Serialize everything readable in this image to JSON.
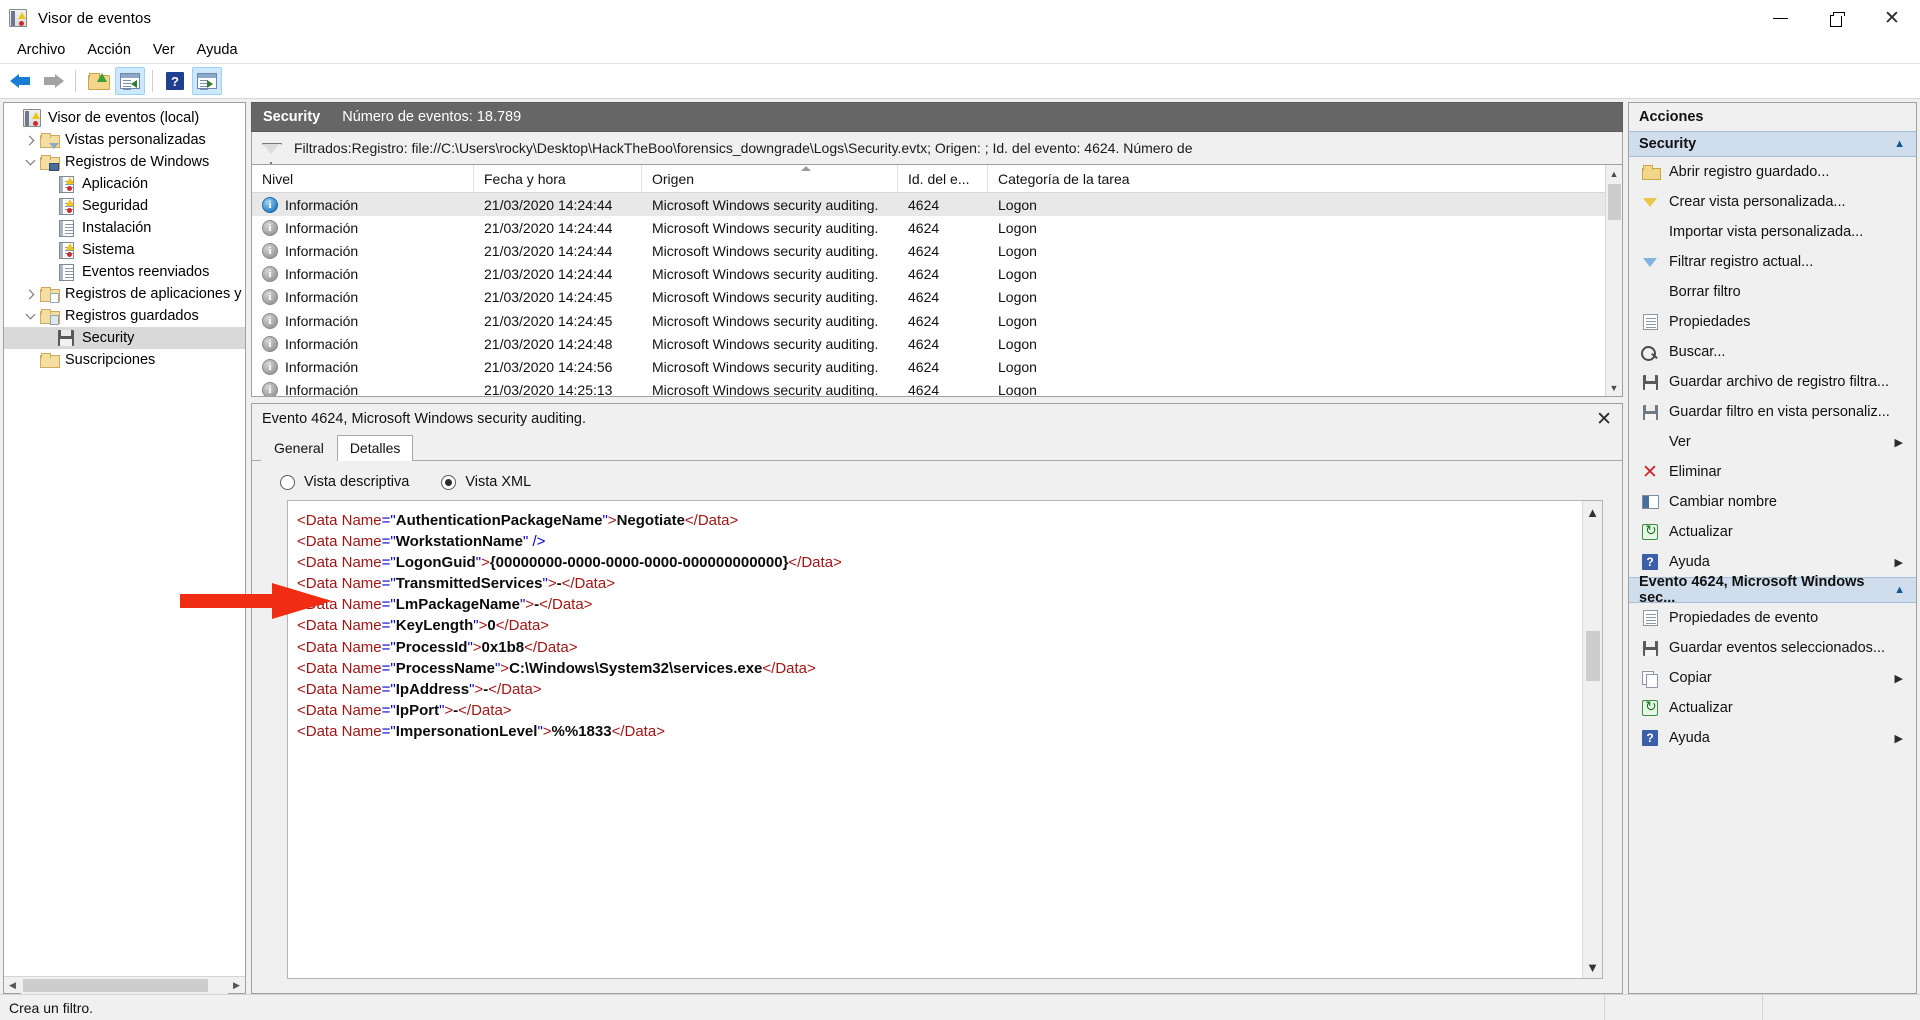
{
  "window": {
    "title": "Visor de eventos",
    "app_icon": "event-viewer-icon",
    "minimize": "—",
    "restore": "restore-icon",
    "close": "✕"
  },
  "menu": {
    "items": [
      "Archivo",
      "Acción",
      "Ver",
      "Ayuda"
    ]
  },
  "toolbar": {
    "buttons": [
      {
        "name": "back-button",
        "icon": "arrow-back-icon"
      },
      {
        "name": "forward-button",
        "icon": "arrow-forward-icon"
      },
      {
        "name": "show-hide-folder-button",
        "icon": "open-folder-icon"
      },
      {
        "name": "show-hide-console-tree-button",
        "icon": "console-tree-pane-icon"
      },
      {
        "name": "help-button",
        "icon": "help-icon"
      },
      {
        "name": "show-hide-action-pane-button",
        "icon": "action-pane-icon"
      }
    ]
  },
  "tree": {
    "items": [
      {
        "label": "Visor de eventos (local)",
        "level": 0,
        "twisty": "none",
        "icon": "event-viewer-icon",
        "selected": false
      },
      {
        "label": "Vistas personalizadas",
        "level": 1,
        "twisty": "right",
        "icon": "folder-filter-icon",
        "selected": false
      },
      {
        "label": "Registros de Windows",
        "level": 1,
        "twisty": "down",
        "icon": "folder-windows-icon",
        "selected": false
      },
      {
        "label": "Aplicación",
        "level": 2,
        "twisty": "none",
        "icon": "log-warn-icon",
        "selected": false
      },
      {
        "label": "Seguridad",
        "level": 2,
        "twisty": "none",
        "icon": "log-warn-icon",
        "selected": false
      },
      {
        "label": "Instalación",
        "level": 2,
        "twisty": "none",
        "icon": "log-icon",
        "selected": false
      },
      {
        "label": "Sistema",
        "level": 2,
        "twisty": "none",
        "icon": "log-warn-icon",
        "selected": false
      },
      {
        "label": "Eventos reenviados",
        "level": 2,
        "twisty": "none",
        "icon": "log-icon",
        "selected": false
      },
      {
        "label": "Registros de aplicaciones y se",
        "level": 1,
        "twisty": "right",
        "icon": "folder-page-icon",
        "selected": false
      },
      {
        "label": "Registros guardados",
        "level": 1,
        "twisty": "down",
        "icon": "folder-stack-icon",
        "selected": false
      },
      {
        "label": "Security",
        "level": 2,
        "twisty": "none",
        "icon": "saved-log-icon",
        "selected": true
      },
      {
        "label": "Suscripciones",
        "level": 1,
        "twisty": "none",
        "icon": "subscriptions-folder-icon",
        "selected": false
      }
    ]
  },
  "log": {
    "name": "Security",
    "event_count_label": "Número de eventos: 18.789",
    "filter_icon": "funnel-icon",
    "filter_text": "Filtrados:Registro: file://C:\\Users\\rocky\\Desktop\\HackTheBoo\\forensics_downgrade\\Logs\\Security.evtx; Origen: ; Id. del evento: 4624. Número de"
  },
  "table": {
    "columns": [
      "Nivel",
      "Fecha y hora",
      "Origen",
      "Id. del e...",
      "Categoría de la tarea"
    ],
    "rows": [
      {
        "nivel": "Información",
        "fecha": "21/03/2020 14:24:44",
        "origen": "Microsoft Windows security auditing.",
        "id": "4624",
        "categoria": "Logon",
        "selected": true
      },
      {
        "nivel": "Información",
        "fecha": "21/03/2020 14:24:44",
        "origen": "Microsoft Windows security auditing.",
        "id": "4624",
        "categoria": "Logon",
        "selected": false
      },
      {
        "nivel": "Información",
        "fecha": "21/03/2020 14:24:44",
        "origen": "Microsoft Windows security auditing.",
        "id": "4624",
        "categoria": "Logon",
        "selected": false
      },
      {
        "nivel": "Información",
        "fecha": "21/03/2020 14:24:44",
        "origen": "Microsoft Windows security auditing.",
        "id": "4624",
        "categoria": "Logon",
        "selected": false
      },
      {
        "nivel": "Información",
        "fecha": "21/03/2020 14:24:45",
        "origen": "Microsoft Windows security auditing.",
        "id": "4624",
        "categoria": "Logon",
        "selected": false
      },
      {
        "nivel": "Información",
        "fecha": "21/03/2020 14:24:45",
        "origen": "Microsoft Windows security auditing.",
        "id": "4624",
        "categoria": "Logon",
        "selected": false
      },
      {
        "nivel": "Información",
        "fecha": "21/03/2020 14:24:48",
        "origen": "Microsoft Windows security auditing.",
        "id": "4624",
        "categoria": "Logon",
        "selected": false
      },
      {
        "nivel": "Información",
        "fecha": "21/03/2020 14:24:56",
        "origen": "Microsoft Windows security auditing.",
        "id": "4624",
        "categoria": "Logon",
        "selected": false
      },
      {
        "nivel": "Información",
        "fecha": "21/03/2020 14:25:13",
        "origen": "Microsoft Windows security auditing.",
        "id": "4624",
        "categoria": "Logon",
        "selected": false
      }
    ]
  },
  "detail": {
    "title": "Evento 4624, Microsoft Windows security auditing.",
    "close_label": "✕",
    "tabs": [
      {
        "label": "General",
        "active": false
      },
      {
        "label": "Detalles",
        "active": true
      }
    ],
    "view_modes": [
      {
        "label": "Vista descriptiva",
        "selected": false
      },
      {
        "label": "Vista XML",
        "selected": true
      }
    ],
    "xml_lines": [
      {
        "tag": "<Data",
        "attr": "Name",
        "eq": "=",
        "q": "\"",
        "value": "AuthenticationPackageName",
        "close_q": "\"",
        "gt": ">",
        "text": "Negotiate",
        "end": "</Data>",
        "self_close": false
      },
      {
        "tag": "<Data",
        "attr": "Name",
        "eq": "=",
        "q": "\"",
        "value": "WorkstationName",
        "close_q": "\"",
        "gt": " />",
        "text": "",
        "end": "",
        "self_close": true
      },
      {
        "tag": "<Data",
        "attr": "Name",
        "eq": "=",
        "q": "\"",
        "value": "LogonGuid",
        "close_q": "\"",
        "gt": ">",
        "text": "{00000000-0000-0000-0000-000000000000}",
        "end": "</Data>",
        "self_close": false
      },
      {
        "tag": "<Data",
        "attr": "Name",
        "eq": "=",
        "q": "\"",
        "value": "TransmittedServices",
        "close_q": "\"",
        "gt": ">",
        "text": "-",
        "end": "</Data>",
        "self_close": false
      },
      {
        "tag": "<Data",
        "attr": "Name",
        "eq": "=",
        "q": "\"",
        "value": "LmPackageName",
        "close_q": "\"",
        "gt": ">",
        "text": "-",
        "end": "</Data>",
        "self_close": false
      },
      {
        "tag": "<Data",
        "attr": "Name",
        "eq": "=",
        "q": "\"",
        "value": "KeyLength",
        "close_q": "\"",
        "gt": ">",
        "text": "0",
        "end": "</Data>",
        "self_close": false
      },
      {
        "tag": "<Data",
        "attr": "Name",
        "eq": "=",
        "q": "\"",
        "value": "ProcessId",
        "close_q": "\"",
        "gt": ">",
        "text": "0x1b8",
        "end": "</Data>",
        "self_close": false
      },
      {
        "tag": "<Data",
        "attr": "Name",
        "eq": "=",
        "q": "\"",
        "value": "ProcessName",
        "close_q": "\"",
        "gt": ">",
        "text": "C:\\Windows\\System32\\services.exe",
        "end": "</Data>",
        "self_close": false
      },
      {
        "tag": "<Data",
        "attr": "Name",
        "eq": "=",
        "q": "\"",
        "value": "IpAddress",
        "close_q": "\"",
        "gt": ">",
        "text": "-",
        "end": "</Data>",
        "self_close": false
      },
      {
        "tag": "<Data",
        "attr": "Name",
        "eq": "=",
        "q": "\"",
        "value": "IpPort",
        "close_q": "\"",
        "gt": ">",
        "text": "-",
        "end": "</Data>",
        "self_close": false
      },
      {
        "tag": "<Data",
        "attr": "Name",
        "eq": "=",
        "q": "\"",
        "value": "ImpersonationLevel",
        "close_q": "\"",
        "gt": ">",
        "text": "%%1833",
        "end": "</Data>",
        "self_close": false
      }
    ]
  },
  "actions": {
    "title": "Acciones",
    "sections": [
      {
        "title": "Security",
        "items": [
          {
            "label": "Abrir registro guardado...",
            "icon": "open-saved-log-icon",
            "submenu": false
          },
          {
            "label": "Crear vista personalizada...",
            "icon": "create-custom-view-icon",
            "submenu": false
          },
          {
            "label": "Importar vista personalizada...",
            "icon": "none",
            "submenu": false
          },
          {
            "label": "Filtrar registro actual...",
            "icon": "filter-icon",
            "submenu": false
          },
          {
            "label": "Borrar filtro",
            "icon": "none",
            "submenu": false
          },
          {
            "label": "Propiedades",
            "icon": "properties-icon",
            "submenu": false
          },
          {
            "label": "Buscar...",
            "icon": "search-icon",
            "submenu": false
          },
          {
            "label": "Guardar archivo de registro filtra...",
            "icon": "save-icon",
            "submenu": false
          },
          {
            "label": "Guardar filtro en vista personaliz...",
            "icon": "save-filter-icon",
            "submenu": false
          },
          {
            "label": "Ver",
            "icon": "none",
            "submenu": true
          },
          {
            "label": "Eliminar",
            "icon": "delete-icon",
            "submenu": false
          },
          {
            "label": "Cambiar nombre",
            "icon": "rename-icon",
            "submenu": false
          },
          {
            "label": "Actualizar",
            "icon": "refresh-icon",
            "submenu": false
          },
          {
            "label": "Ayuda",
            "icon": "help-icon",
            "submenu": true
          }
        ]
      },
      {
        "title": "Evento 4624, Microsoft Windows sec...",
        "items": [
          {
            "label": "Propiedades de evento",
            "icon": "properties-icon",
            "submenu": false
          },
          {
            "label": "Guardar eventos seleccionados...",
            "icon": "save-icon",
            "submenu": false
          },
          {
            "label": "Copiar",
            "icon": "copy-icon",
            "submenu": true
          },
          {
            "label": "Actualizar",
            "icon": "refresh-icon",
            "submenu": false
          },
          {
            "label": "Ayuda",
            "icon": "help-icon",
            "submenu": true
          }
        ]
      }
    ]
  },
  "statusbar": {
    "text": "Crea un filtro."
  },
  "annotation": {
    "arrow_color": "#f02d12",
    "points_to": "AuthenticationPackageName"
  }
}
